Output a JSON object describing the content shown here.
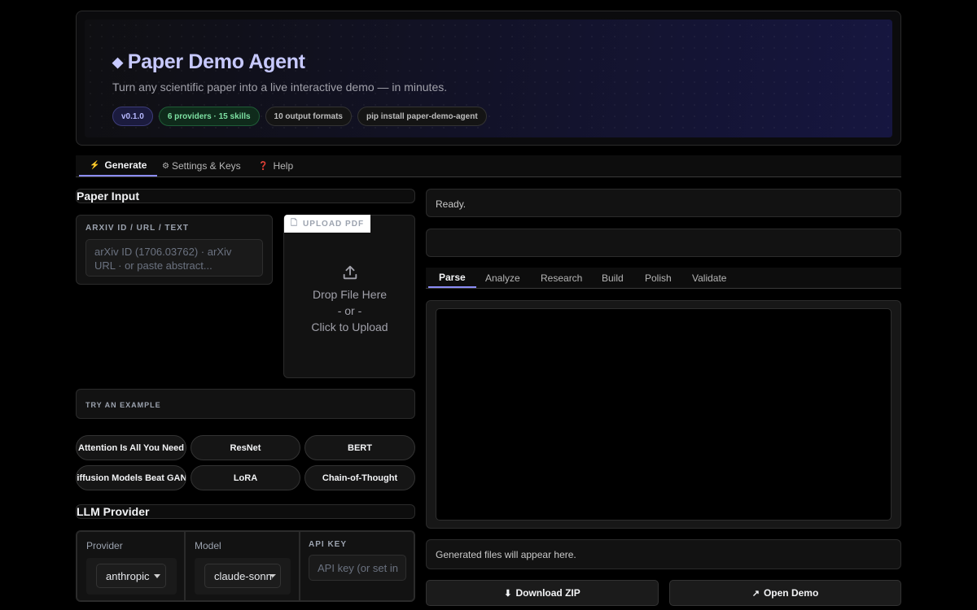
{
  "header": {
    "icon": "diamond-icon",
    "title": "Paper Demo Agent",
    "subtitle": "Turn any scientific paper into a live interactive demo — in minutes.",
    "badges": [
      "v0.1.0",
      "6 providers · 15 skills",
      "10 output formats",
      "pip install paper-demo-agent"
    ]
  },
  "main_tabs": [
    {
      "icon": "⚡",
      "label": "Generate"
    },
    {
      "icon": "⚙",
      "label": "Settings & Keys"
    },
    {
      "icon": "❓",
      "label": "Help"
    }
  ],
  "paper_input": {
    "heading": "Paper Input",
    "text_label": "ARXIV ID / URL / TEXT",
    "text_placeholder": "arXiv ID (1706.03762) · arXiv URL · or paste abstract...",
    "upload_label": "UPLOAD PDF",
    "drop_line1": "Drop File Here",
    "drop_line2": "- or -",
    "drop_line3": "Click to Upload",
    "examples_label": "TRY AN EXAMPLE",
    "examples": [
      "Attention Is All You Need",
      "ResNet",
      "BERT",
      "Diffusion Models Beat GANs",
      "LoRA",
      "Chain-of-Thought"
    ]
  },
  "llm": {
    "heading": "LLM Provider",
    "provider_label": "Provider",
    "provider_value": "anthropic",
    "model_label": "Model",
    "model_value": "claude-sonnet",
    "api_key_label": "API KEY",
    "api_key_placeholder": "API key (or set in"
  },
  "status": {
    "text": "Ready."
  },
  "pipeline_tabs": [
    "Parse",
    "Analyze",
    "Research",
    "Build",
    "Polish",
    "Validate"
  ],
  "files": {
    "text": "Generated files will appear here."
  },
  "actions": {
    "download_icon": "⬇",
    "download_label": "Download ZIP",
    "open_icon": "↗",
    "open_label": "Open Demo"
  },
  "colors": {
    "accent": "#8b8cf5",
    "title": "#c7c9ff"
  }
}
